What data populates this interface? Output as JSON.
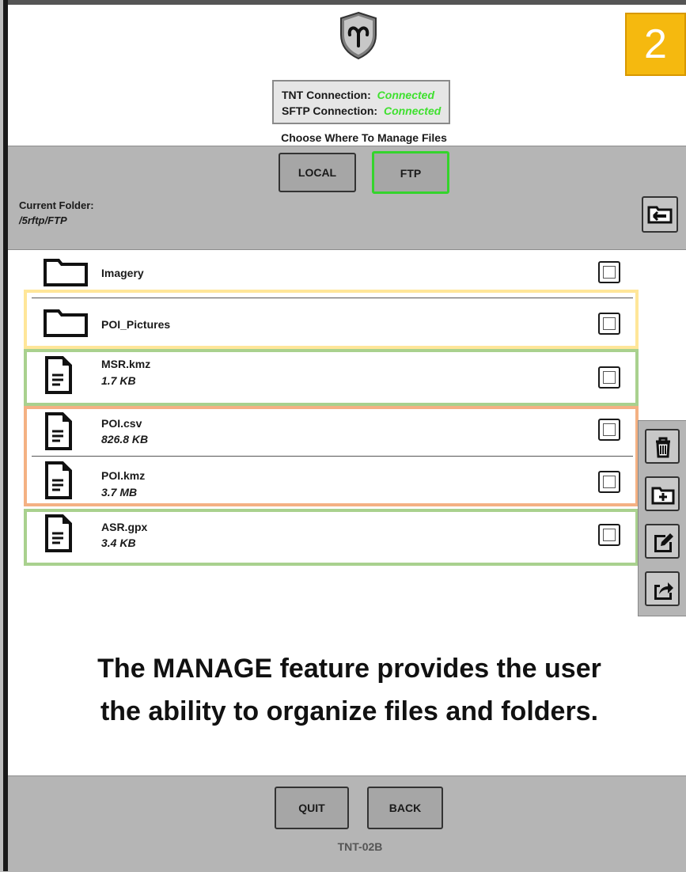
{
  "badge": "2",
  "connection": {
    "tnt_label": "TNT Connection:",
    "tnt_status": "Connected",
    "sftp_label": "SFTP Connection:",
    "sftp_status": "Connected",
    "status_color": "#3fe02f"
  },
  "location": {
    "prompt": "Choose Where To Manage Files",
    "local_label": "LOCAL",
    "ftp_label": "FTP",
    "selected": "FTP",
    "current_folder_label": "Current Folder:",
    "current_folder_path": "/5rftp/FTP"
  },
  "files": [
    {
      "name": "Imagery",
      "type": "folder",
      "size": "",
      "checked": false
    },
    {
      "name": "POI_Pictures",
      "type": "folder",
      "size": "",
      "checked": false
    },
    {
      "name": "MSR.kmz",
      "type": "file",
      "size": "1.7 KB",
      "checked": false
    },
    {
      "name": "POI.csv",
      "type": "file",
      "size": "826.8 KB",
      "checked": false
    },
    {
      "name": "POI.kmz",
      "type": "file",
      "size": "3.7 MB",
      "checked": false
    },
    {
      "name": "ASR.gpx",
      "type": "file",
      "size": "3.4 KB",
      "checked": false
    }
  ],
  "tools": [
    "trash-icon",
    "add-folder-icon",
    "edit-icon",
    "share-icon"
  ],
  "caption": {
    "line1": "The MANAGE feature provides the user",
    "line2": "the ability to organize files and folders."
  },
  "footer": {
    "quit_label": "QUIT",
    "back_label": "BACK",
    "device": "TNT-02B"
  },
  "colors": {
    "highlight_yellow": "#ffe699",
    "highlight_green": "#a9d18e",
    "highlight_orange": "#f4b183",
    "badge": "#f5b90f"
  }
}
